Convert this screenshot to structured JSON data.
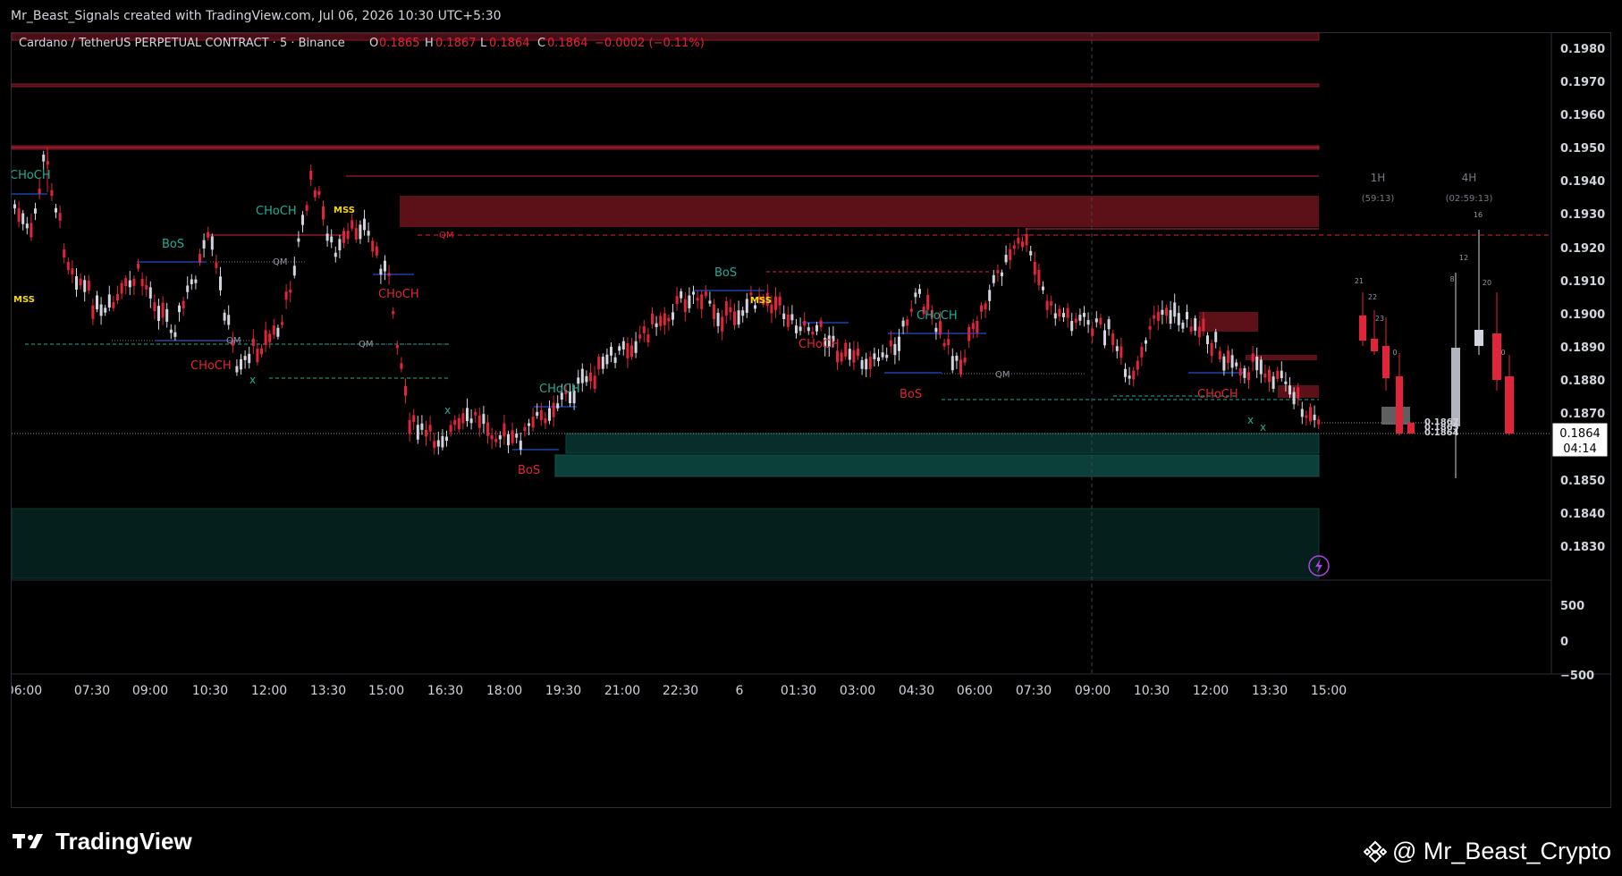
{
  "header": {
    "credit": "Mr_Beast_Signals created with TradingView.com, Jul 06, 2026 10:30 UTC+5:30"
  },
  "legend": {
    "symbol": "Cardano / TetherUS PERPETUAL CONTRACT · 5 · Binance",
    "o_label": "O",
    "o": "0.1865",
    "h_label": "H",
    "h": "0.1867",
    "l_label": "L",
    "l": "0.1864",
    "c_label": "C",
    "c": "0.1864",
    "change": "−0.0002 (−0.11%)"
  },
  "price_axis": {
    "ticks": [
      "0.1980",
      "0.1970",
      "0.1960",
      "0.1950",
      "0.1940",
      "0.1930",
      "0.1920",
      "0.1910",
      "0.1900",
      "0.1890",
      "0.1880",
      "0.1870",
      "0.1850",
      "0.1840",
      "0.1830"
    ],
    "current_price": "0.1864",
    "countdown": "04:14"
  },
  "indicator_axis": {
    "ticks": [
      "500",
      "0",
      "−500"
    ]
  },
  "time_axis": {
    "labels": [
      "06:00",
      "07:30",
      "09:00",
      "10:30",
      "12:00",
      "13:30",
      "15:00",
      "16:30",
      "18:00",
      "19:30",
      "21:00",
      "22:30",
      "6",
      "01:30",
      "03:00",
      "04:30",
      "06:00",
      "07:30",
      "09:00",
      "10:30",
      "12:00",
      "13:30",
      "15:00"
    ]
  },
  "annotations": {
    "choch": "CHoCH",
    "bos": "BoS",
    "mss": "MSS",
    "qm": "QM",
    "x": "x"
  },
  "htf": {
    "h1_label": "1H",
    "h1_timer": "(59:13)",
    "h4_label": "4H",
    "h4_timer": "(02:59:13)",
    "small_labels": [
      "21",
      "22",
      "23",
      "0",
      "8",
      "12",
      "16",
      "20",
      "0"
    ],
    "price_labels": [
      "0.1867",
      "0.1865",
      "0.1864"
    ]
  },
  "footer": {
    "logo_text": "TradingView",
    "watermark": "@ Mr_Beast_Crypto"
  },
  "colors": {
    "bull": "#d1d4dc",
    "bear": "#e0243a",
    "teal": "#22ab94",
    "supply": "#5c1119",
    "demand": "#0b3f39",
    "structure_blue": "#2962ff",
    "mss_yellow": "#f5d90a",
    "alert_purple": "#b440e6"
  }
}
